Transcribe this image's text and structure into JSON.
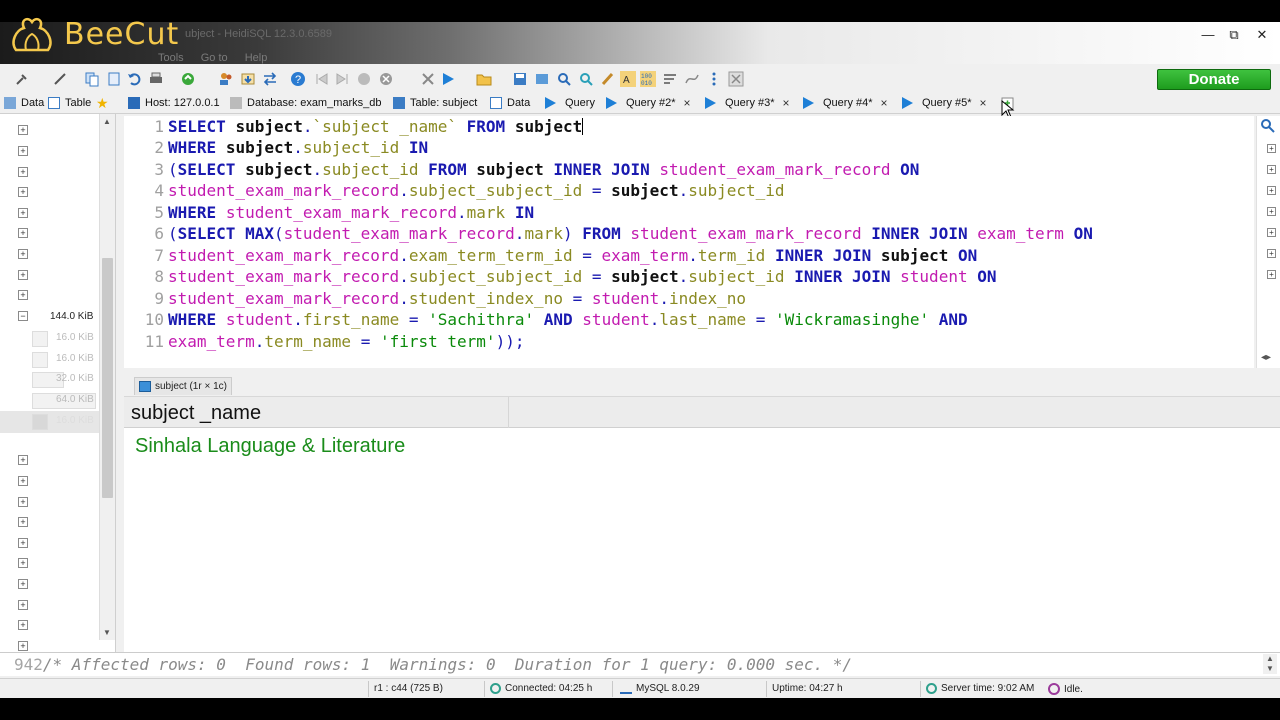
{
  "overlay": {
    "logo_text": "BeeCut"
  },
  "window": {
    "title": "ubject - HeidiSQL 12.3.0.6589",
    "menu": [
      "Tools",
      "Go to",
      "Help"
    ],
    "controls": {
      "minimize": "—",
      "restore": "⧉",
      "close": "✕"
    }
  },
  "toolbar": {
    "donate_label": "Donate"
  },
  "tabs": {
    "left": [
      {
        "label": "Data",
        "icon": "data-icon"
      },
      {
        "label": "Table",
        "icon": "table-icon"
      }
    ],
    "host": "Host: 127.0.0.1",
    "database": "Database: exam_marks_db",
    "table": "Table: subject",
    "data": "Data",
    "queries": [
      "Query",
      "Query #2*",
      "Query #3*",
      "Query #4*",
      "Query #5*"
    ],
    "close_glyph": "×"
  },
  "tree": {
    "expanded_size": "144.0 KiB",
    "child_sizes": [
      "16.0 KiB",
      "16.0 KiB",
      "32.0 KiB",
      "64.0 KiB",
      "16.0 KiB"
    ]
  },
  "editor": {
    "line_numbers": [
      "1",
      "2",
      "3",
      "4",
      "5",
      "6",
      "7",
      "8",
      "9",
      "10",
      "11"
    ],
    "lines": [
      "SELECT subject.`subject _name` FROM subject",
      "WHERE subject.subject_id IN",
      "(SELECT subject.subject_id FROM subject INNER JOIN student_exam_mark_record ON",
      "student_exam_mark_record.subject_subject_id = subject.subject_id",
      "WHERE student_exam_mark_record.mark IN",
      "(SELECT MAX(student_exam_mark_record.mark) FROM student_exam_mark_record INNER JOIN exam_term ON",
      "student_exam_mark_record.exam_term_term_id = exam_term.term_id INNER JOIN subject ON",
      "student_exam_mark_record.subject_subject_id = subject.subject_id INNER JOIN student ON",
      "student_exam_mark_record.student_index_no = student.index_no",
      "WHERE student.first_name = 'Sachithra' AND student.last_name = 'Wickramasinghe' AND",
      "exam_term.term_name = 'first term'));"
    ]
  },
  "result": {
    "tab_label": "subject (1r × 1c)",
    "columns": [
      "subject _name"
    ],
    "rows": [
      [
        "Sinhala Language & Literature"
      ]
    ]
  },
  "log": {
    "line_number": "942",
    "message": "/* Affected rows: 0  Found rows: 1  Warnings: 0  Duration for 1 query: 0.000 sec. */"
  },
  "status": {
    "cursor": "r1 : c44 (725 B)",
    "connected": "Connected: 04:25 h",
    "server_version": "MySQL 8.0.29",
    "uptime": "Uptime: 04:27 h",
    "server_time": "Server time: 9:02 AM",
    "state": "Idle."
  },
  "colors": {
    "keyword": "#1a1ab0",
    "table_name": "#c21bb0",
    "column_name": "#8a8a22",
    "string": "#0a8a0a",
    "result_text": "#1a8c1a",
    "donate": "#2fb12f",
    "logo": "#f4c84c"
  }
}
